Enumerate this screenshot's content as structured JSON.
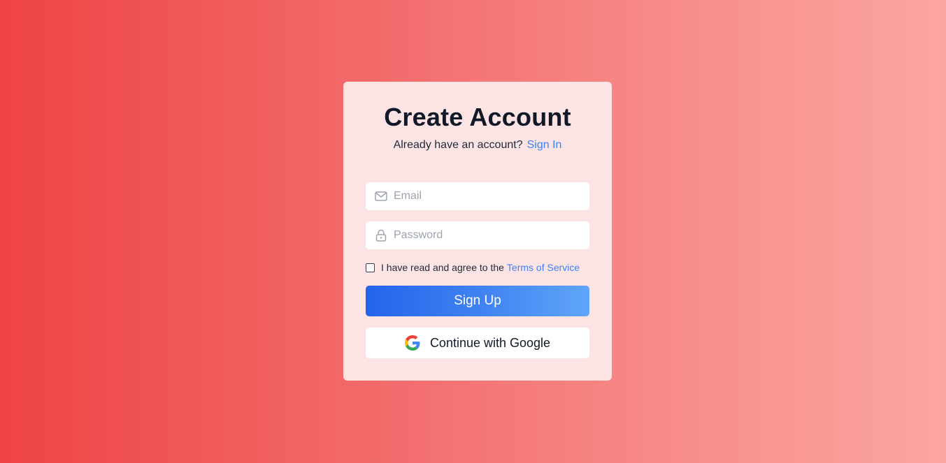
{
  "page": {
    "background_colors": [
      "#ef4444",
      "#fba5a2"
    ]
  },
  "card": {
    "title": "Create Account",
    "subtitle": {
      "text": "Already have an account?",
      "link_label": "Sign In"
    },
    "email": {
      "value": "",
      "placeholder": "Email",
      "icon": "mail-icon"
    },
    "password": {
      "value": "",
      "placeholder": "Password",
      "icon": "lock-icon"
    },
    "terms": {
      "checked": false,
      "text": "I have read and agree to the",
      "link_label": "Terms of Service"
    },
    "signup_label": "Sign Up",
    "google": {
      "label": "Continue with Google",
      "icon": "google-icon"
    }
  },
  "colors": {
    "accent": "#3b82f6",
    "button_start": "#2563eb",
    "button_end": "#60a5fa",
    "card_bg": "#fde4e4",
    "title": "#111827"
  }
}
